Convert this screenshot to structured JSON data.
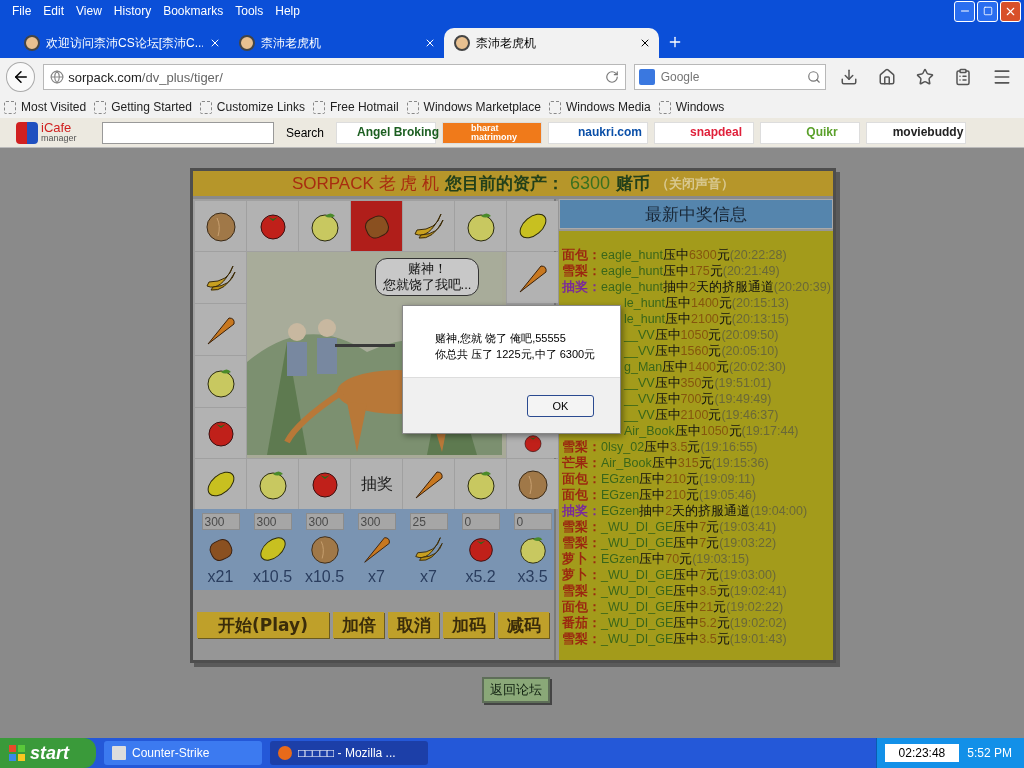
{
  "menu": [
    "File",
    "Edit",
    "View",
    "History",
    "Bookmarks",
    "Tools",
    "Help"
  ],
  "tabs": [
    {
      "label": "欢迎访问柰沛CS论坛[柰沛C...",
      "selected": false
    },
    {
      "label": "柰沛老虎机",
      "selected": false
    },
    {
      "label": "柰沛老虎机",
      "selected": true
    }
  ],
  "address": {
    "host": "sorpack.com",
    "path": "/dv_plus/tiger/"
  },
  "search": {
    "placeholder": "Google"
  },
  "bookmarks": [
    "Most Visited",
    "Getting Started",
    "Customize Links",
    "Free Hotmail",
    "Windows Marketplace",
    "Windows Media",
    "Windows"
  ],
  "toolbar": {
    "logo": "iCafe",
    "logo_sub": "manager",
    "search_button": "Search",
    "links": [
      {
        "label": "Angel Broking",
        "kind": "plain",
        "color": "#1b5e20"
      },
      {
        "label": "bharat matrimony",
        "kind": "filled",
        "color": "#f07a1a"
      },
      {
        "label": "naukri.com",
        "kind": "plain",
        "color": "#0a4fa8"
      },
      {
        "label": "snapdeal",
        "kind": "plain",
        "color": "#e0203a"
      },
      {
        "label": "Quikr",
        "kind": "plain",
        "color": "#5aa02a"
      },
      {
        "label": "moviebuddy",
        "kind": "plain",
        "color": "#222222"
      }
    ]
  },
  "game": {
    "title": "SORPACK 老 虎 机",
    "assets_label": "您目前的资产：",
    "assets": "6300",
    "currency": "赌币",
    "sound_toggle": "（关闭声音）",
    "top_row": [
      {
        "kind": "peach",
        "selected": false
      },
      {
        "kind": "tomato",
        "selected": false
      },
      {
        "kind": "apple",
        "selected": false
      },
      {
        "kind": "bread",
        "selected": true
      },
      {
        "kind": "banana",
        "selected": false
      },
      {
        "kind": "apple",
        "selected": false
      },
      {
        "kind": "lemon",
        "selected": false
      }
    ],
    "left_column": [
      {
        "kind": "banana",
        "selected": false
      },
      {
        "kind": "carrot",
        "selected": false
      },
      {
        "kind": "apple",
        "selected": false
      },
      {
        "kind": "tomato",
        "selected": false
      }
    ],
    "right_column": [
      {
        "kind": "carrot",
        "selected": false
      },
      {
        "kind": "tomato",
        "selected": false
      }
    ],
    "bottom_row": [
      {
        "kind": "lemon",
        "selected": false
      },
      {
        "kind": "apple",
        "selected": false
      },
      {
        "kind": "tomato",
        "selected": false
      },
      {
        "kind": "text",
        "label": "抽奖",
        "selected": false
      },
      {
        "kind": "carrot",
        "selected": false
      },
      {
        "kind": "apple",
        "selected": false
      },
      {
        "kind": "peach",
        "selected": false
      }
    ],
    "bubble": [
      "赌神！",
      "您就饶了我吧..."
    ],
    "bets": [
      {
        "amount": "300",
        "kind": "bread",
        "odds": "x21"
      },
      {
        "amount": "300",
        "kind": "lemon",
        "odds": "x10.5"
      },
      {
        "amount": "300",
        "kind": "peach",
        "odds": "x10.5"
      },
      {
        "amount": "300",
        "kind": "carrot",
        "odds": "x7"
      },
      {
        "amount": "25",
        "kind": "banana",
        "odds": "x7"
      },
      {
        "amount": "0",
        "kind": "tomato",
        "odds": "x5.2"
      },
      {
        "amount": "0",
        "kind": "apple",
        "odds": "x3.5"
      }
    ],
    "buttons": [
      {
        "label": "开始(Play)",
        "wide": true
      },
      {
        "label": "加倍",
        "wide": false
      },
      {
        "label": "取消",
        "wide": false
      },
      {
        "label": "加码",
        "wide": false
      },
      {
        "label": "减码",
        "wide": false
      }
    ],
    "back_button": "返回论坛"
  },
  "winners": {
    "title": "最新中奖信息",
    "rows": [
      {
        "kind": "win",
        "prize": "面包：",
        "user": "eagle_hunt",
        "verb": "压中",
        "amount": "6300",
        "unit": "元",
        "time": "(20:22:28)"
      },
      {
        "kind": "win",
        "prize": "雪梨：",
        "user": "eagle_hunt",
        "verb": "压中",
        "amount": "175",
        "unit": "元",
        "time": "(20:21:49)"
      },
      {
        "kind": "lottery",
        "prize": "抽奖：",
        "user": "eagle_hunt",
        "verb": "抽中",
        "amount": "2",
        "unit": "天的挤服通道",
        "time": "(20:20:39)"
      },
      {
        "user": "le_hunt",
        "verb": "压中",
        "amount": "1400",
        "unit": "元",
        "time": "(20:15:13)"
      },
      {
        "user": "le_hunt",
        "verb": "压中",
        "amount": "2100",
        "unit": "元",
        "time": "(20:13:15)"
      },
      {
        "user": "__VV",
        "verb": "压中",
        "amount": "1050",
        "unit": "元",
        "time": "(20:09:50)"
      },
      {
        "user": "__VV",
        "verb": "压中",
        "amount": "1560",
        "unit": "元",
        "time": "(20:05:10)"
      },
      {
        "user": "g_Man",
        "verb": "压中",
        "amount": "1400",
        "unit": "元",
        "time": "(20:02:30)"
      },
      {
        "user": "__VV",
        "verb": "压中",
        "amount": "350",
        "unit": "元",
        "time": "(19:51:01)"
      },
      {
        "user": "__VV",
        "verb": "压中",
        "amount": "700",
        "unit": "元",
        "time": "(19:49:49)"
      },
      {
        "user": "__VV",
        "verb": "压中",
        "amount": "2100",
        "unit": "元",
        "time": "(19:46:37)"
      },
      {
        "user": "Air_Book",
        "verb": "压中",
        "amount": "1050",
        "unit": "元",
        "time": "(19:17:44)"
      },
      {
        "kind": "win",
        "prize": "雪梨：",
        "user": "0lsy_02",
        "verb": "压中",
        "amount": "3.5",
        "unit": "元",
        "time": "(19:16:55)"
      },
      {
        "kind": "win",
        "prize": "芒果：",
        "user": "Air_Book",
        "verb": "压中",
        "amount": "315",
        "unit": "元",
        "time": "(19:15:36)"
      },
      {
        "kind": "win",
        "prize": "面包：",
        "user": "EGzen",
        "verb": "压中",
        "amount": "210",
        "unit": "元",
        "time": "(19:09:11)"
      },
      {
        "kind": "win",
        "prize": "面包：",
        "user": "EGzen",
        "verb": "压中",
        "amount": "210",
        "unit": "元",
        "time": "(19:05:46)"
      },
      {
        "kind": "lottery",
        "prize": "抽奖：",
        "user": "EGzen",
        "verb": "抽中",
        "amount": "2",
        "unit": "天的挤服通道",
        "time": "(19:04:00)"
      },
      {
        "kind": "win",
        "prize": "雪梨：",
        "user": "_WU_DI_GE",
        "verb": "压中",
        "amount": "7",
        "unit": "元",
        "time": "(19:03:41)"
      },
      {
        "kind": "win",
        "prize": "雪梨：",
        "user": "_WU_DI_GE",
        "verb": "压中",
        "amount": "7",
        "unit": "元",
        "time": "(19:03:22)"
      },
      {
        "kind": "win",
        "prize": "萝卜：",
        "user": "EGzen",
        "verb": "压中",
        "amount": "70",
        "unit": "元",
        "time": "(19:03:15)"
      },
      {
        "kind": "win",
        "prize": "萝卜：",
        "user": "_WU_DI_GE",
        "verb": "压中",
        "amount": "7",
        "unit": "元",
        "time": "(19:03:00)"
      },
      {
        "kind": "win",
        "prize": "雪梨：",
        "user": "_WU_DI_GE",
        "verb": "压中",
        "amount": "3.5",
        "unit": "元",
        "time": "(19:02:41)"
      },
      {
        "kind": "win",
        "prize": "面包：",
        "user": "_WU_DI_GE",
        "verb": "压中",
        "amount": "21",
        "unit": "元",
        "time": "(19:02:22)"
      },
      {
        "kind": "win",
        "prize": "番茄：",
        "user": "_WU_DI_GE",
        "verb": "压中",
        "amount": "5.2",
        "unit": "元",
        "time": "(19:02:02)"
      },
      {
        "kind": "win",
        "prize": "雪梨：",
        "user": "_WU_DI_GE",
        "verb": "压中",
        "amount": "3.5",
        "unit": "元",
        "time": "(19:01:43)"
      }
    ]
  },
  "dialog": {
    "lines": [
      "赌神,您就 饶了 俺吧,55555",
      "你总共 压了 1225元,中了 6300元"
    ],
    "button": "OK"
  },
  "taskbar": {
    "start": "start",
    "tasks": [
      {
        "label": "Counter-Strike",
        "selected": false
      },
      {
        "label": "□□□□□ - Mozilla ...",
        "selected": true
      }
    ],
    "timer": "02:23:48",
    "clock": "5:52 PM"
  }
}
